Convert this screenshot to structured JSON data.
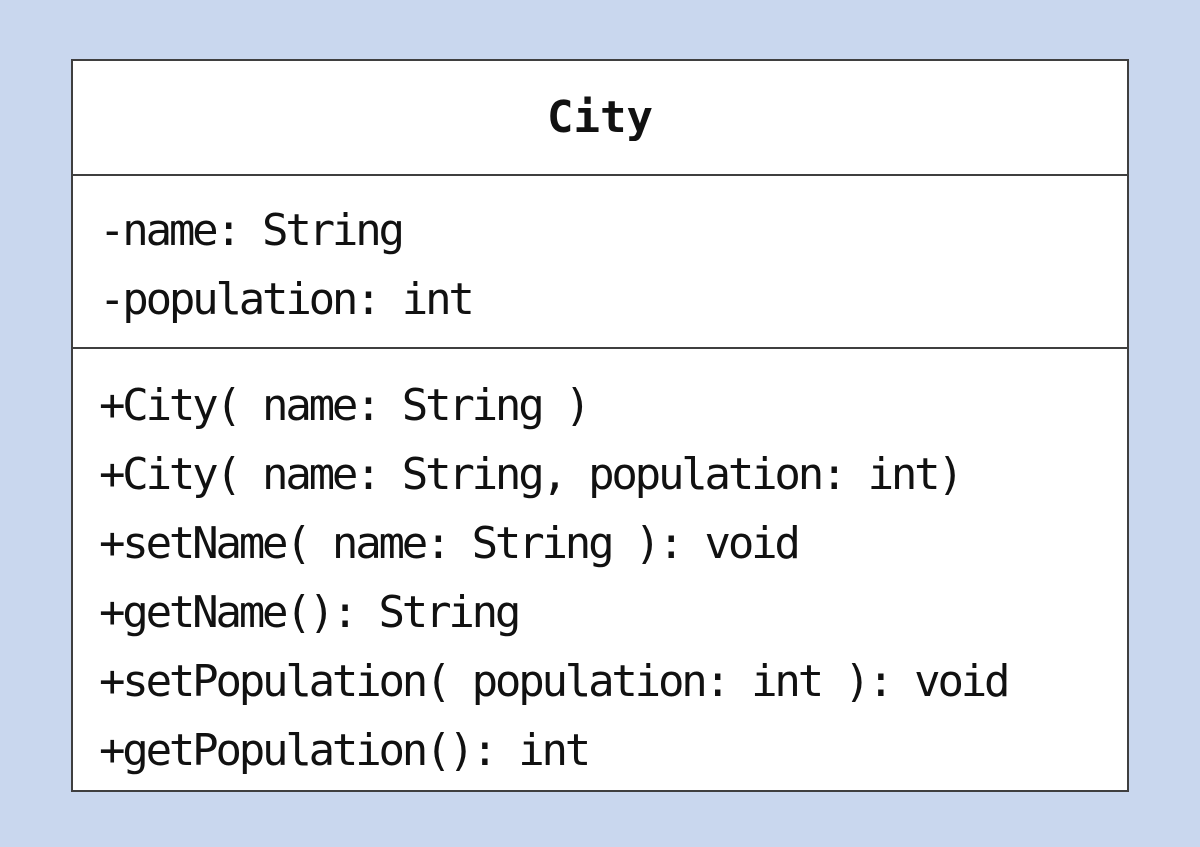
{
  "diagram": {
    "colors": {
      "background": "#c9d7ee",
      "box_fill": "#ffffff",
      "border": "#3f3f3f",
      "text": "#111111"
    },
    "class": {
      "name": "City",
      "attributes": [
        "-name: String",
        "-population: int"
      ],
      "operations": [
        "+City( name: String )",
        "+City( name: String, population: int)",
        "+setName( name: String ): void",
        "+getName(): String",
        "+setPopulation( population: int ): void",
        "+getPopulation(): int"
      ]
    }
  }
}
